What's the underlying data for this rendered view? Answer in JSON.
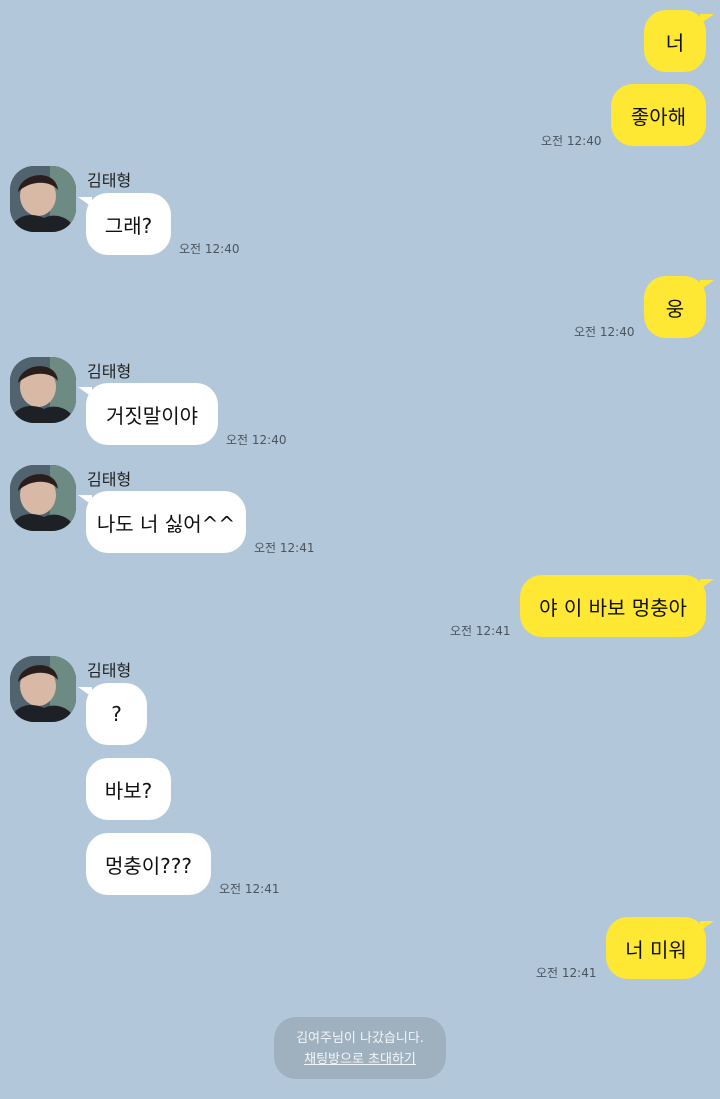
{
  "contact": {
    "name": "김태형"
  },
  "messages": [
    {
      "from": "me",
      "text": "너"
    },
    {
      "from": "me",
      "text": "좋아해",
      "time": "오전 12:40"
    },
    {
      "from": "them",
      "text": "그래?",
      "time": "오전 12:40"
    },
    {
      "from": "me",
      "text": "웅",
      "time": "오전 12:40"
    },
    {
      "from": "them",
      "text": "거짓말이야",
      "time": "오전 12:40"
    },
    {
      "from": "them",
      "text": "나도 너 싫어^^",
      "time": "오전 12:41"
    },
    {
      "from": "me",
      "text": "야 이 바보 멍충아",
      "time": "오전 12:41"
    },
    {
      "from": "them",
      "text": "?"
    },
    {
      "from": "them",
      "text": "바보?"
    },
    {
      "from": "them",
      "text": "멍충이???",
      "time": "오전 12:41"
    },
    {
      "from": "me",
      "text": "너 미워",
      "time": "오전 12:41"
    }
  ],
  "system_notice": {
    "text": "김여주님이 나갔습니다.",
    "invite_link": "채팅방으로 초대하기"
  },
  "colors": {
    "background": "#b2c7d9",
    "my_bubble": "#fee833",
    "their_bubble": "#ffffff"
  }
}
